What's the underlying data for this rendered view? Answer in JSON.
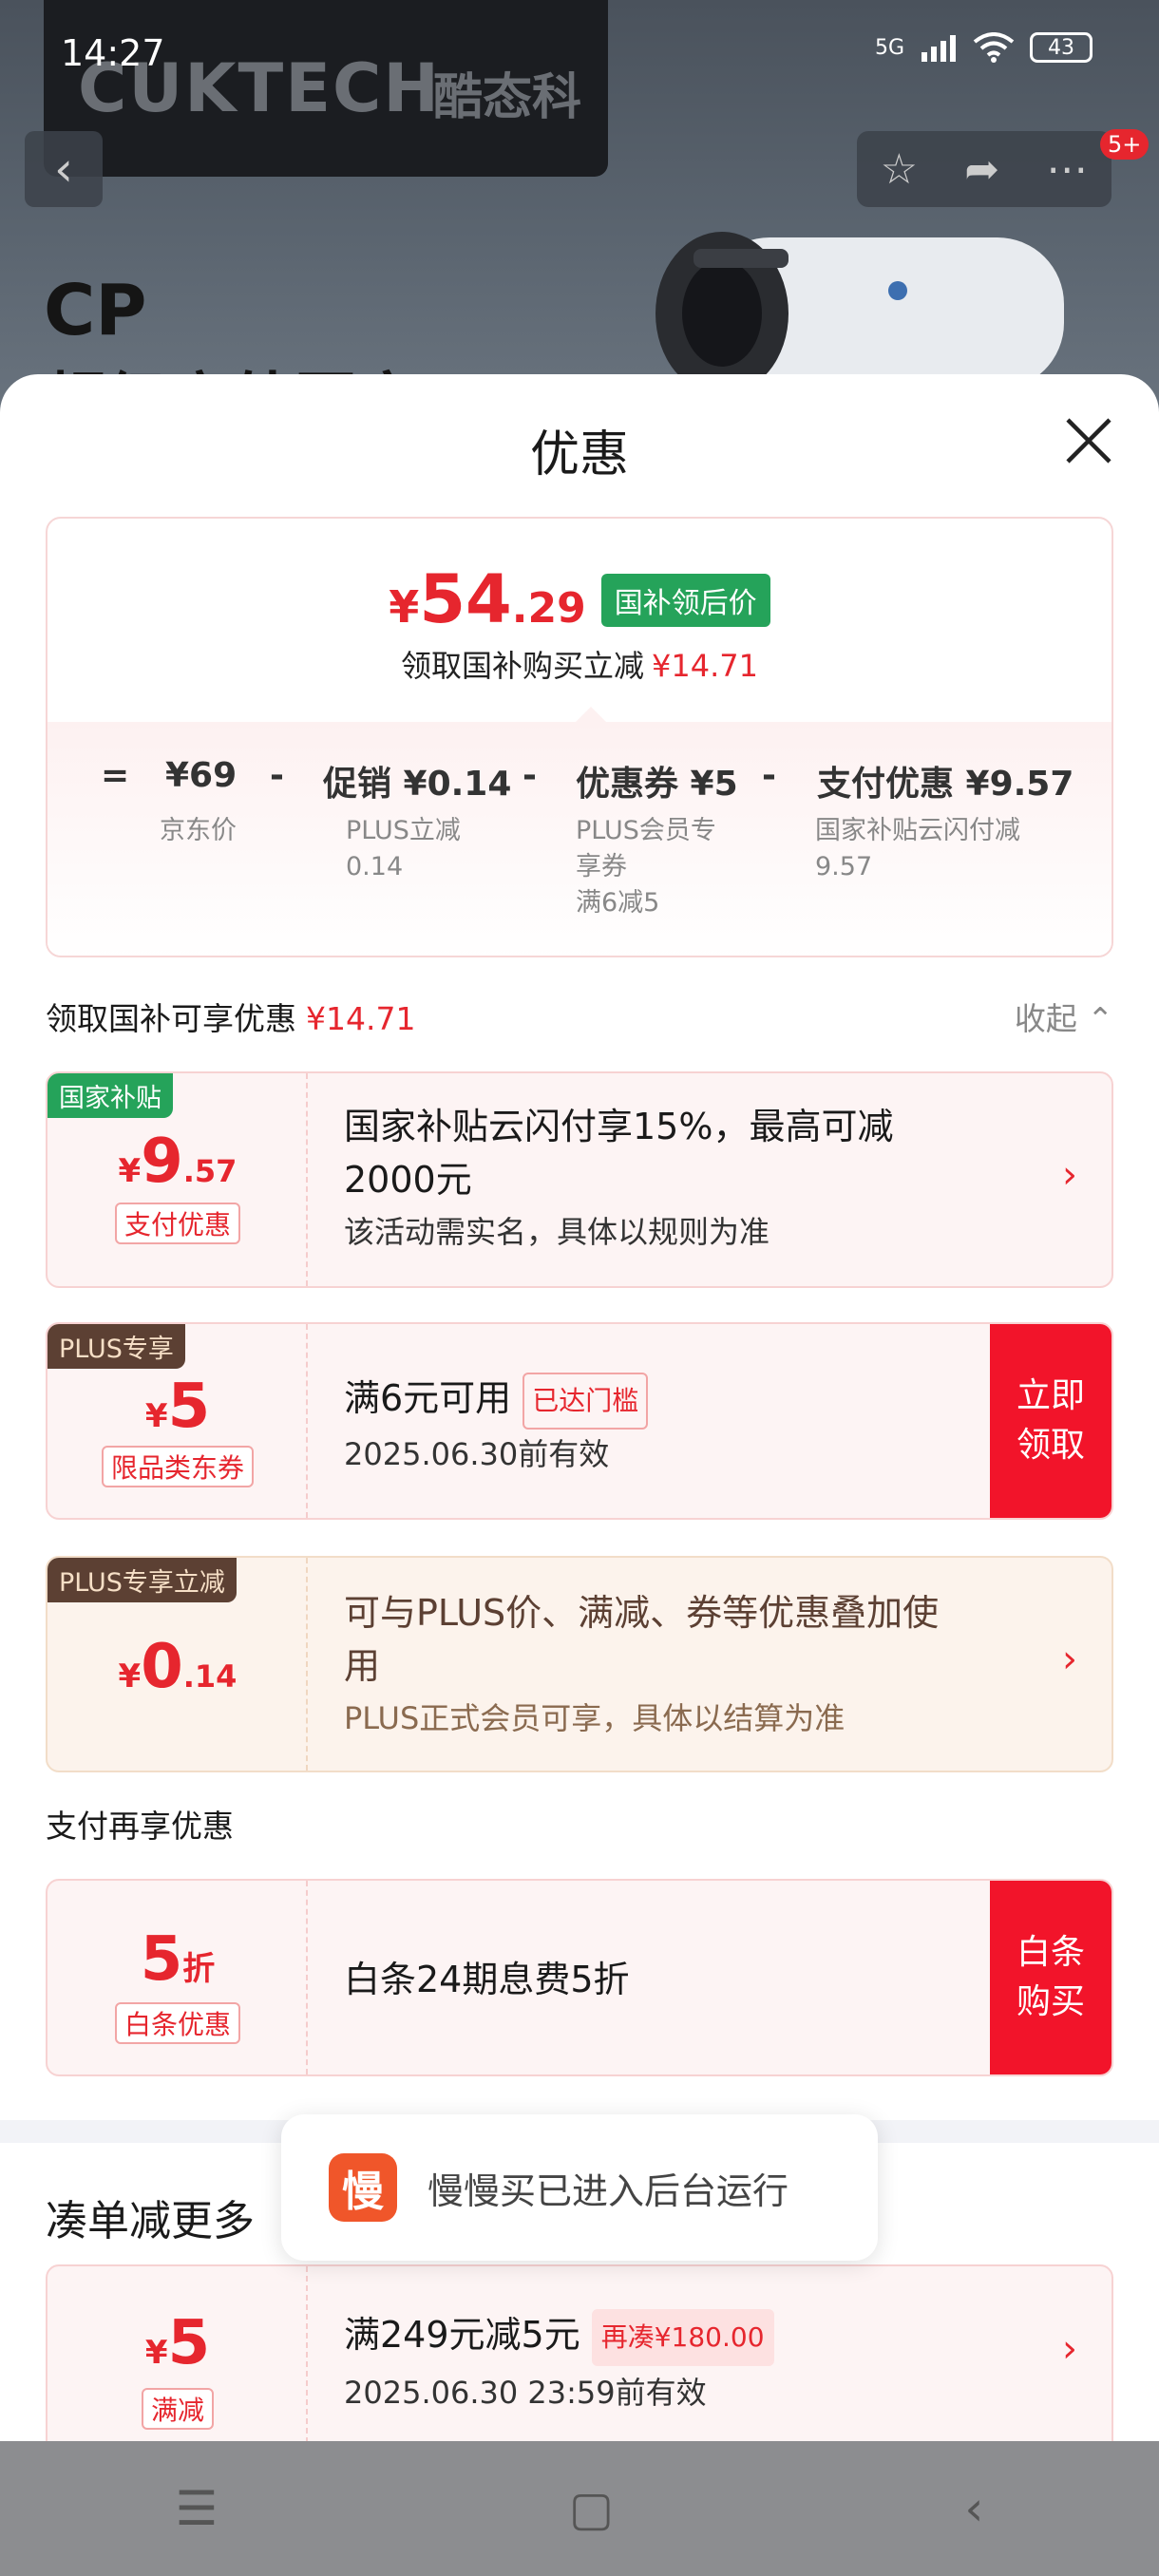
{
  "status_bar": {
    "time": "14:27",
    "network": "5G",
    "battery": "43"
  },
  "background": {
    "brand": "CUKTECH",
    "brand_cn": "酷态科",
    "product_line1": "CP",
    "product_line2": "超级户外国家",
    "cart_badge": "5+"
  },
  "sheet": {
    "title": "优惠"
  },
  "summary": {
    "price_symbol": "¥",
    "price_int": "54",
    "price_dec": ".29",
    "price_tag": "国补领后价",
    "note": "领取国补购买立减",
    "note_amount": "¥14.71",
    "calc": [
      {
        "label": "="
      },
      {
        "label": "¥69",
        "sub": "京东价"
      },
      {
        "label": "-"
      },
      {
        "label": "促销 ¥0.14",
        "sub1": "PLUS立减",
        "sub2": "0.14"
      },
      {
        "label": "-"
      },
      {
        "label": "优惠券 ¥5",
        "sub1": "PLUS会员专",
        "sub2": "享券",
        "sub3": "满6减5"
      },
      {
        "label": "-"
      },
      {
        "label": "支付优惠 ¥9.57",
        "sub1": "国家补贴云闪付减",
        "sub2": "9.57"
      }
    ]
  },
  "section1": {
    "title": "领取国补可享优惠",
    "amount": "¥14.71",
    "collapse": "收起"
  },
  "coupons": [
    {
      "tag": "国家补贴",
      "sym": "¥",
      "int": "9",
      "dec": ".57",
      "type": "支付优惠",
      "title_line1": "国家补贴云闪付享15%，最高可减",
      "title_line2": "2000元",
      "sub": "该活动需实名，具体以规则为准"
    },
    {
      "tag": "PLUS专享",
      "sym": "¥",
      "int": "5",
      "type": "限品类东券",
      "title": "满6元可用",
      "badge": "已达门槛",
      "sub": "2025.06.30前有效",
      "btn": "立即领取",
      "btn1": "立即",
      "btn2": "领取"
    },
    {
      "tag": "PLUS专享立减",
      "sym": "¥",
      "int": "0",
      "dec": ".14",
      "title_line1": "可与PLUS价、满减、券等优惠叠加使",
      "title_line2": "用",
      "sub": "PLUS正式会员可享，具体以结算为准"
    }
  ],
  "section2": {
    "title": "支付再享优惠"
  },
  "payment": {
    "int": "5",
    "unit": "折",
    "type": "白条优惠",
    "title": "白条24期息费5折",
    "btn1": "白条",
    "btn2": "购买"
  },
  "section3": {
    "title": "凑单减更多"
  },
  "bundle": {
    "sym": "¥",
    "int": "5",
    "type": "满减",
    "title": "满249元减5元",
    "badge": "再凑¥180.00",
    "sub": "2025.06.30 23:59前有效"
  },
  "toast": {
    "icon": "慢",
    "text": "慢慢买已进入后台运行"
  }
}
